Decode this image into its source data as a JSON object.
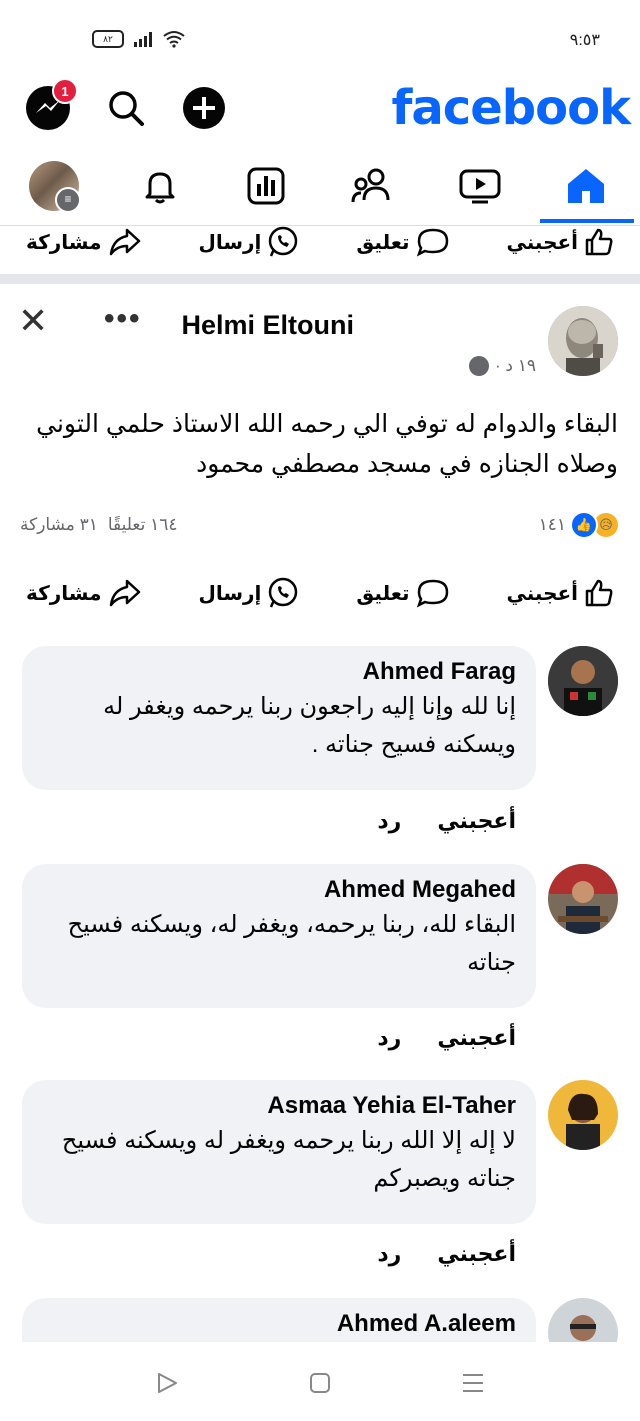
{
  "status_bar": {
    "time": "٩:٥٣",
    "battery": "٨٢"
  },
  "header": {
    "logo": "facebook",
    "messenger_badge": "1"
  },
  "top_action_row": {
    "like": "أعجبني",
    "comment": "تعليق",
    "send": "إرسال",
    "share": "مشاركة"
  },
  "post": {
    "author": "Helmi Eltouni",
    "time": "١٩ د ·",
    "text": "البقاء والدوام له توفي الي رحمه الله الاستاذ حلمي التوني وصلاه الجنازه في مسجد مصطفي محمود",
    "reactions_count": "١٤١",
    "comments_count": "١٦٤ تعليقًا",
    "shares_count": "٣١ مشاركة",
    "actions": {
      "like": "أعجبني",
      "comment": "تعليق",
      "send": "إرسال",
      "share": "مشاركة"
    }
  },
  "comments": [
    {
      "name": "Ahmed Farag",
      "text": "إنا لله وإنا إليه راجعون ربنا يرحمه ويغفر له ويسكنه فسيح جناته .",
      "like": "أعجبني",
      "reply": "رد"
    },
    {
      "name": "Ahmed Megahed",
      "text": "البقاء لله، ربنا يرحمه، ويغفر له، ويسكنه فسيح جناته",
      "like": "أعجبني",
      "reply": "رد"
    },
    {
      "name": "Asmaa Yehia El-Taher",
      "text": "لا إله إلا الله ربنا يرحمه ويغفر له ويسكنه فسيح جناته ويصبركم",
      "like": "أعجبني",
      "reply": "رد"
    },
    {
      "name": "Ahmed A.aleem",
      "text": "",
      "like": "",
      "reply": ""
    }
  ],
  "colors": {
    "brand": "#0866ff",
    "badge": "#e41e3f",
    "bubble": "#f0f2f5",
    "muted": "#65676b"
  }
}
